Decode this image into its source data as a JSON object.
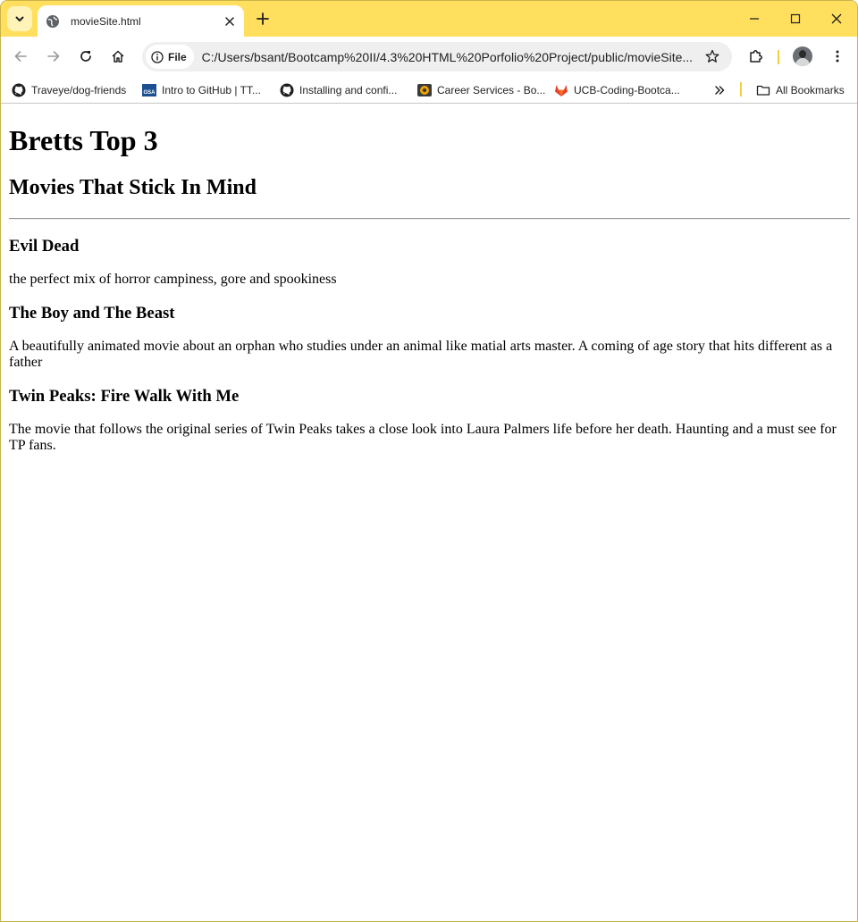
{
  "browser": {
    "tab_title": "movieSite.html",
    "site_chip_label": "File",
    "url": "C:/Users/bsant/Bootcamp%20II/4.3%20HTML%20Porfolio%20Project/public/movieSite....",
    "bookmarks": [
      {
        "label": "Traveye/dog-friends",
        "icon": "github-icon"
      },
      {
        "label": "Intro to GitHub | TT...",
        "icon": "gsa-icon"
      },
      {
        "label": "Installing and confi...",
        "icon": "github-icon"
      },
      {
        "label": "Career Services - Bo...",
        "icon": "career-services-icon"
      },
      {
        "label": "UCB-Coding-Bootca...",
        "icon": "gitlab-icon"
      }
    ],
    "all_bookmarks_label": "All Bookmarks",
    "accent_color": "#ffdf5d"
  },
  "page": {
    "heading": "Bretts Top 3",
    "subheading": "Movies That Stick In Mind",
    "movies": [
      {
        "title": "Evil Dead",
        "description": "the perfect mix of horror campiness, gore and spookiness"
      },
      {
        "title": "The Boy and The Beast",
        "description": "A beautifully animated movie about an orphan who studies under an animal like matial arts master. A coming of age story that hits different as a father"
      },
      {
        "title": "Twin Peaks: Fire Walk With Me",
        "description": "The movie that follows the original series of Twin Peaks takes a close look into Laura Palmers life before her death. Haunting and a must see for TP fans."
      }
    ]
  }
}
